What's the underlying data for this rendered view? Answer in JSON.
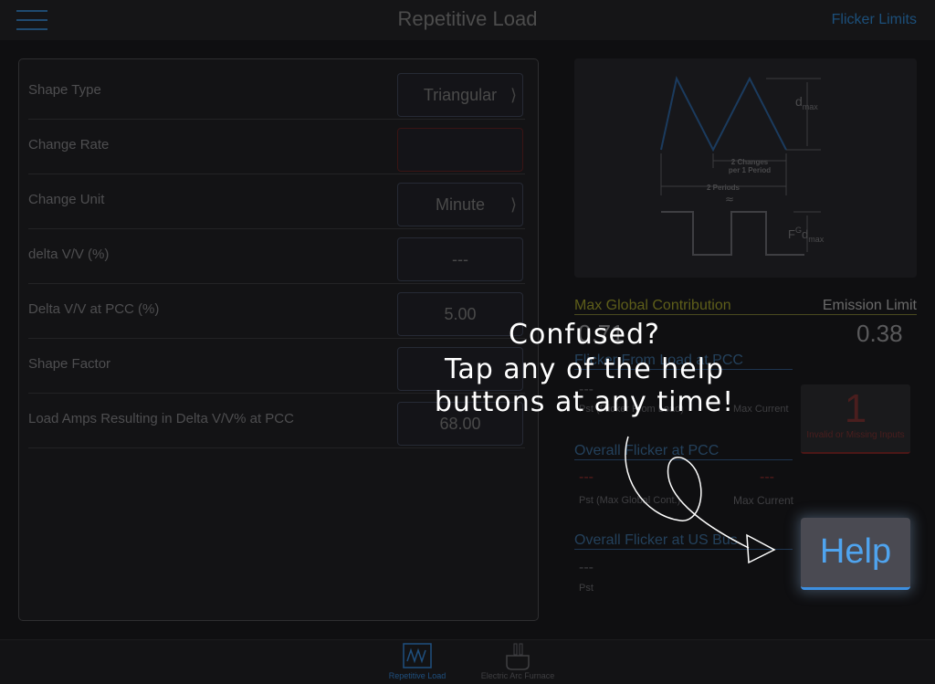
{
  "nav": {
    "title": "Repetitive Load",
    "right_link": "Flicker Limits"
  },
  "form": {
    "rows": [
      {
        "label": "Shape Type",
        "value": "Triangular"
      },
      {
        "label": "Change Rate",
        "value": ""
      },
      {
        "label": "Change Unit",
        "value": "Minute"
      },
      {
        "label": "delta V/V (%)",
        "value": "---"
      },
      {
        "label": "Delta V/V at PCC (%)",
        "value": "5.00"
      },
      {
        "label": "Shape Factor",
        "value": ""
      },
      {
        "label": "Load Amps Resulting in Delta V/V% at PCC",
        "value": "68.00"
      }
    ]
  },
  "diagram": {
    "dmax": "d",
    "dmax_sub": "max",
    "changes_line1": "2 Changes",
    "changes_line2": "per 1 Period",
    "periods": "2 Periods",
    "approx": "≈",
    "fg": "F",
    "fg_sup": "G",
    "fg_d": "d",
    "fg_sub": "max"
  },
  "results": {
    "max_global": "Max Global Contribution",
    "emission_limit": "Emission Limit",
    "max_global_value": "0.71",
    "emission_value": "0.38",
    "flicker_load_pcc": "Flicker From Load at PCC",
    "pst_load": "Pst (Flicker From Load)",
    "max_current": "Max Current",
    "overall_pcc": "Overall Flicker at PCC",
    "pst_max_global": "Pst (Max Global Cont.)",
    "max_current2": "Max Current",
    "overall_us_bus": "Overall Flicker at US Bus",
    "pst": "Pst",
    "dash": "---"
  },
  "error": {
    "count": "1",
    "text": "Invalid or Missing Inputs"
  },
  "help": {
    "label": "Help"
  },
  "overlay": {
    "line1": "Confused?",
    "line2": "Tap any of the help",
    "line3": "buttons at any time!"
  },
  "tabs": [
    {
      "label": "Repetitive Load",
      "color": "#1f4f7e"
    },
    {
      "label": "Electric Arc Furnace",
      "color": "#3f3f42"
    }
  ]
}
